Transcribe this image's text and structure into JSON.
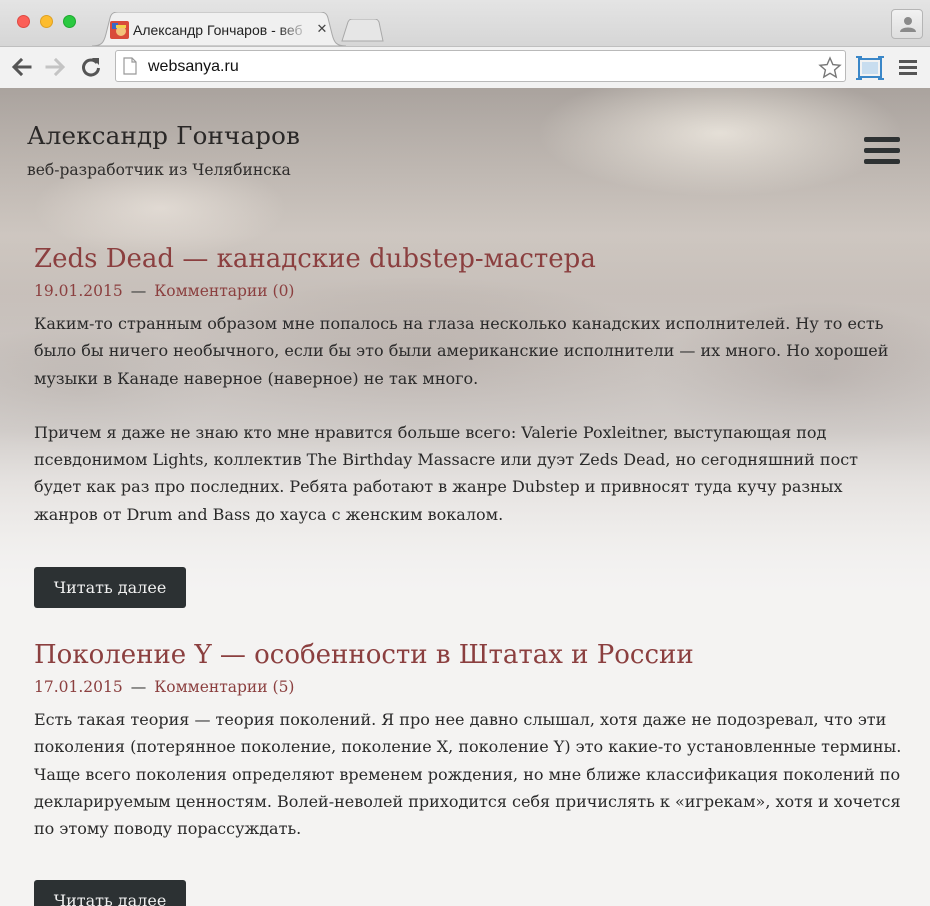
{
  "browser": {
    "tab_title": "Александр Гончаров - веб",
    "tab_close": "✕",
    "url": "websanya.ru"
  },
  "site": {
    "title": "Александр Гончаров",
    "subtitle": "веб-разработчик из Челябинска"
  },
  "posts": [
    {
      "title": "Zeds Dead — канадские dubstep-мастера",
      "date": "19.01.2015",
      "separator": "—",
      "comments": "Комментарии (0)",
      "paragraphs": [
        "Каким-то странным образом мне попалось на глаза несколько канадских исполнителей. Ну то есть было бы ничего необычного, если бы это были американские исполнители — их много. Но хорошей музыки в Канаде наверное (наверное) не так много.",
        "Причем я даже не знаю кто мне нравится больше всего: Valerie Poxleitner, выступающая под псевдонимом Lights, коллектив The Birthday Massacre или дуэт Zeds Dead, но сегодняшний пост будет как раз про последних. Ребята работают в жанре Dubstep и привносят туда кучу разных жанров от Drum and Bass до хауса с женским вокалом."
      ],
      "read_more": "Читать далее"
    },
    {
      "title": "Поколение Y — особенности в Штатах и России",
      "date": "17.01.2015",
      "separator": "—",
      "comments": "Комментарии (5)",
      "paragraphs": [
        "Есть такая теория — теория поколений. Я про нее давно слышал, хотя даже не подозревал, что эти поколения (потерянное поколение, поколение X, поколение Y) это какие-то установленные термины. Чаще всего поколения определяют временем рождения, но мне ближе классификация поколений по декларируемым ценностям. Волей-неволей приходится себя причислять к «игрекам», хотя и хочется по этому поводу порассуждать."
      ],
      "read_more": "Читать далее"
    }
  ],
  "icons": {
    "back": "arrow-left-icon",
    "forward": "arrow-right-icon",
    "reload": "reload-icon",
    "page": "page-icon",
    "bookmark": "star-icon",
    "cast": "cast-icon",
    "menu": "hamburger-icon",
    "profile": "person-icon"
  },
  "colors": {
    "link": "#8b3f3f",
    "button_bg": "#2c3133",
    "text": "#2a2a2a"
  }
}
